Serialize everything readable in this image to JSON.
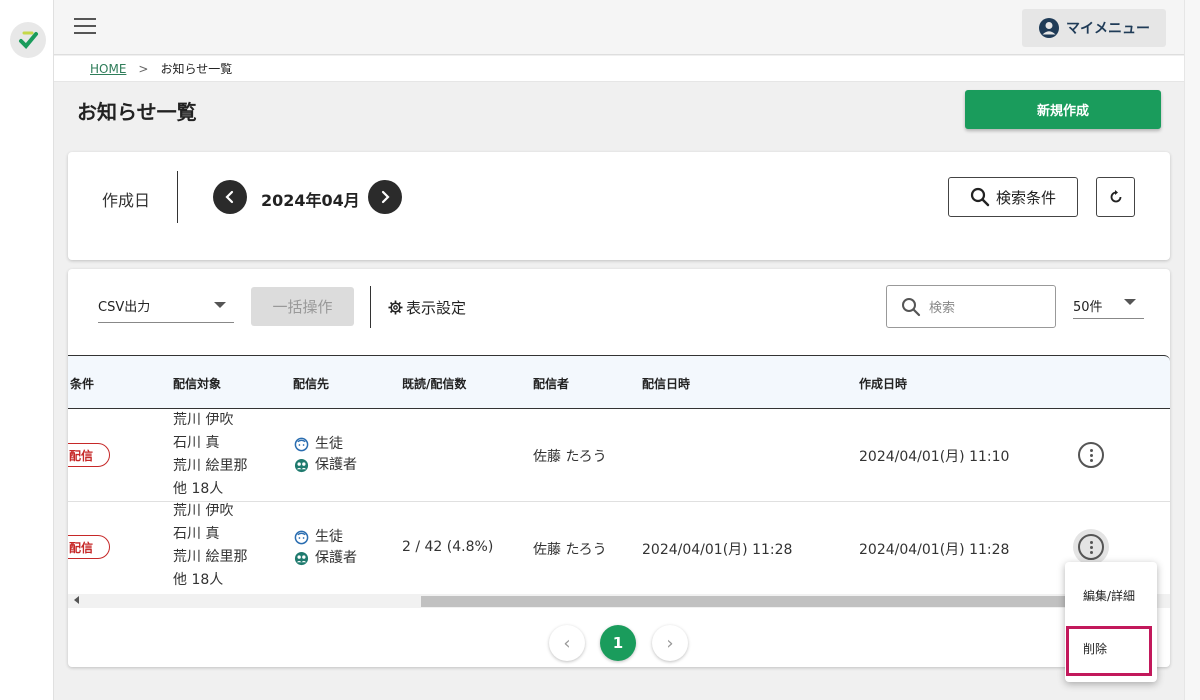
{
  "header": {
    "my_menu_label": "マイメニュー"
  },
  "breadcrumb": {
    "home": "HOME",
    "separator": ">",
    "current": "お知らせ一覧"
  },
  "page": {
    "title": "お知らせ一覧",
    "new_button": "新規作成"
  },
  "filter": {
    "date_label": "作成日",
    "month": "2024年04月",
    "search_conditions": "検索条件"
  },
  "toolbar": {
    "csv_label": "CSV出力",
    "bulk_label": "一括操作",
    "display_settings": "表示設定",
    "search_placeholder": "検索",
    "count_label": "50件"
  },
  "table": {
    "headers": [
      "条件",
      "配信対象",
      "配信先",
      "既読/配信数",
      "配信者",
      "配信日時",
      "作成日時"
    ],
    "rows": [
      {
        "condition": "配信",
        "targets": [
          "荒川 伊吹",
          "石川 真",
          "荒川 絵里那",
          "他 18人"
        ],
        "destinations": [
          "生徒",
          "保護者"
        ],
        "read_count": "",
        "sender": "佐藤 たろう",
        "delivered_at": "",
        "created_at": "2024/04/01(月) 11:10"
      },
      {
        "condition": "配信",
        "targets": [
          "荒川 伊吹",
          "石川 真",
          "荒川 絵里那",
          "他 18人"
        ],
        "destinations": [
          "生徒",
          "保護者"
        ],
        "read_count": "2 / 42 (4.8%)",
        "sender": "佐藤 たろう",
        "delivered_at": "2024/04/01(月) 11:28",
        "created_at": "2024/04/01(月) 11:28"
      }
    ]
  },
  "pagination": {
    "current": "1",
    "prev": "‹",
    "next": "›"
  },
  "context_menu": {
    "edit": "編集/詳細",
    "delete": "削除"
  },
  "colors": {
    "primary": "#1a9c5c",
    "badge": "#c62828",
    "highlight": "#c2185b",
    "header_bg": "#f3f8fd"
  }
}
